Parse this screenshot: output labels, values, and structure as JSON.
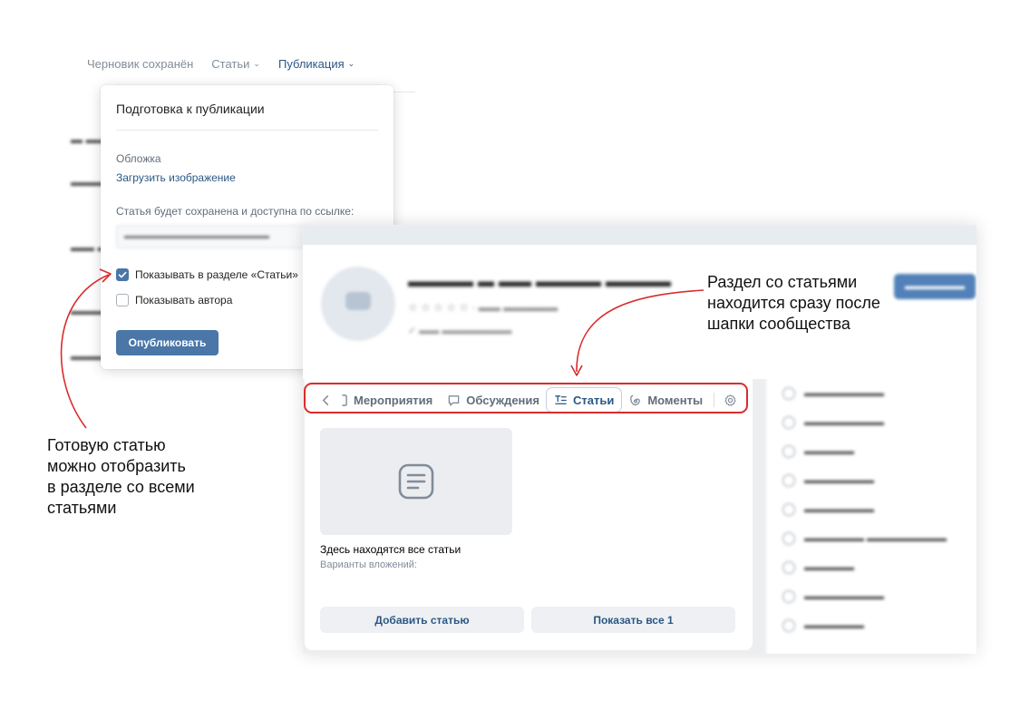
{
  "editor": {
    "draft_status": "Черновик сохранён",
    "menu_articles": "Статьи",
    "menu_publication": "Публикация"
  },
  "publish_popup": {
    "title": "Подготовка к публикации",
    "cover_label": "Обложка",
    "upload_link": "Загрузить изображение",
    "link_label": "Статья будет сохранена и доступна по ссылке:",
    "checkbox_show_in_section": "Показывать в разделе «Статьи»",
    "checkbox_show_author": "Показывать автора",
    "publish_button": "Опубликовать",
    "show_in_section_checked": true,
    "show_author_checked": false
  },
  "community": {
    "tabs": {
      "events": "Мероприятия",
      "discussions": "Обсуждения",
      "articles": "Статьи",
      "moments": "Моменты"
    },
    "active_tab": "Статьи",
    "articles_block": {
      "title": "Здесь находятся все статьи",
      "subtitle": "Варианты вложений:",
      "add_button": "Добавить статью",
      "show_all_button": "Показать все 1"
    }
  },
  "annotations": {
    "right_note": [
      "Раздел со статьями",
      "находится сразу после",
      "шапки сообщества"
    ],
    "left_note": [
      "Готовую статью",
      "можно отобразить",
      "в разделе со всеми",
      "статьями"
    ],
    "arrow_color": "#d92c2c"
  },
  "colors": {
    "accent": "#4a76a8",
    "link": "#2a5885",
    "highlight": "#d92c2c"
  }
}
